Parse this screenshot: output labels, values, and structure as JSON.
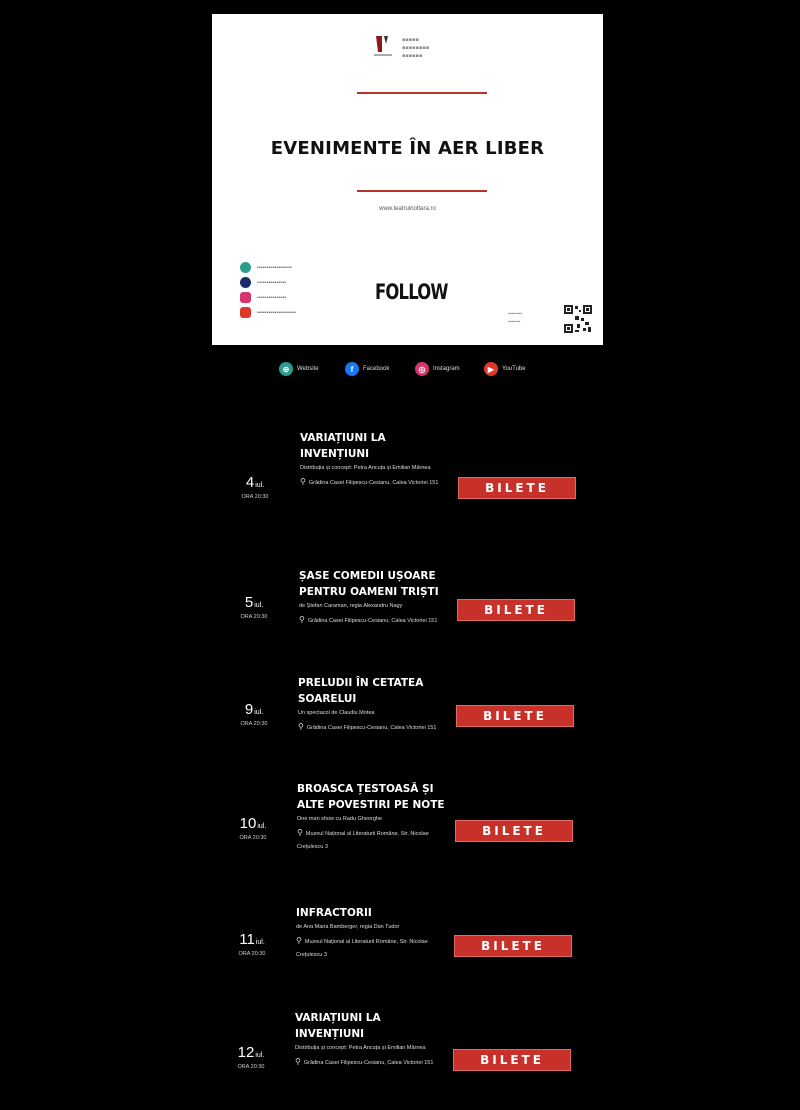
{
  "card": {
    "title": "EVENIMENTE ÎN AER LIBER",
    "url": "www.teatrulnottara.ro",
    "follow": "FOLLOW",
    "rule_color": "#b5332a"
  },
  "links": [
    {
      "label": "Website",
      "icon": "globe-icon",
      "color": "#2a9d8f"
    },
    {
      "label": "Facebook",
      "icon": "facebook-icon",
      "color": "#1877f2"
    },
    {
      "label": "Instagram",
      "icon": "instagram-icon",
      "color": "#d6336c"
    },
    {
      "label": "YouTube",
      "icon": "youtube-icon",
      "color": "#e0372c"
    }
  ],
  "events": [
    {
      "day": "4",
      "month": "iul.",
      "time": "ORA 20:30",
      "title": "VARIAȚIUNI LA INVENȚIUNI",
      "subtitle": "Distribuția și concept: Petra Ancuța și Emilian Mârnea",
      "location": "Grădina Casei Filipescu-Cesianu, Calea Victoriei 151",
      "button": "BILETE"
    },
    {
      "day": "5",
      "month": "iul.",
      "time": "ORA 20:30",
      "title": "ȘASE COMEDII UȘOARE PENTRU OAMENI TRIȘTI",
      "subtitle": "de Ștefan Caraman, regia Alexandru Nagy",
      "location": "Grădina Casei Filipescu-Cesianu, Calea Victoriei 151",
      "button": "BILETE"
    },
    {
      "day": "9",
      "month": "iul.",
      "time": "ORA 20:30",
      "title": "PRELUDII ÎN CETATEA SOARELUI",
      "subtitle": "Un spectacol de Claudiu Motea",
      "location": "Grădina Casei Filipescu-Cesianu, Calea Victoriei 151",
      "button": "BILETE"
    },
    {
      "day": "10",
      "month": "iul.",
      "time": "ORA 20:30",
      "title": "BROASCA ȚESTOASĂ ȘI ALTE POVESTIRI PE NOTE",
      "subtitle": "One man show cu Radu Gheorghe",
      "location": "Muzeul Național al Literaturii Române, Str. Nicolae Crețulescu 3",
      "button": "BILETE"
    },
    {
      "day": "11",
      "month": "iul.",
      "time": "ORA 20:30",
      "title": "INFRACTORII",
      "subtitle": "de Ana Maria Bamberger, regia Dan Tudor",
      "location": "Muzeul Național al Literaturii Române, Str. Nicolae Crețulescu 3",
      "button": "BILETE"
    },
    {
      "day": "12",
      "month": "iul.",
      "time": "ORA 20:30",
      "title": "VARIAȚIUNI LA INVENȚIUNI",
      "subtitle": "Distribuția și concept: Petra Ancuța și Emilian Mârnea",
      "location": "Grădina Casei Filipescu-Cesianu, Calea Victoriei 151",
      "button": "BILETE"
    }
  ],
  "colors": {
    "accent": "#c8302a",
    "background": "#000000"
  }
}
